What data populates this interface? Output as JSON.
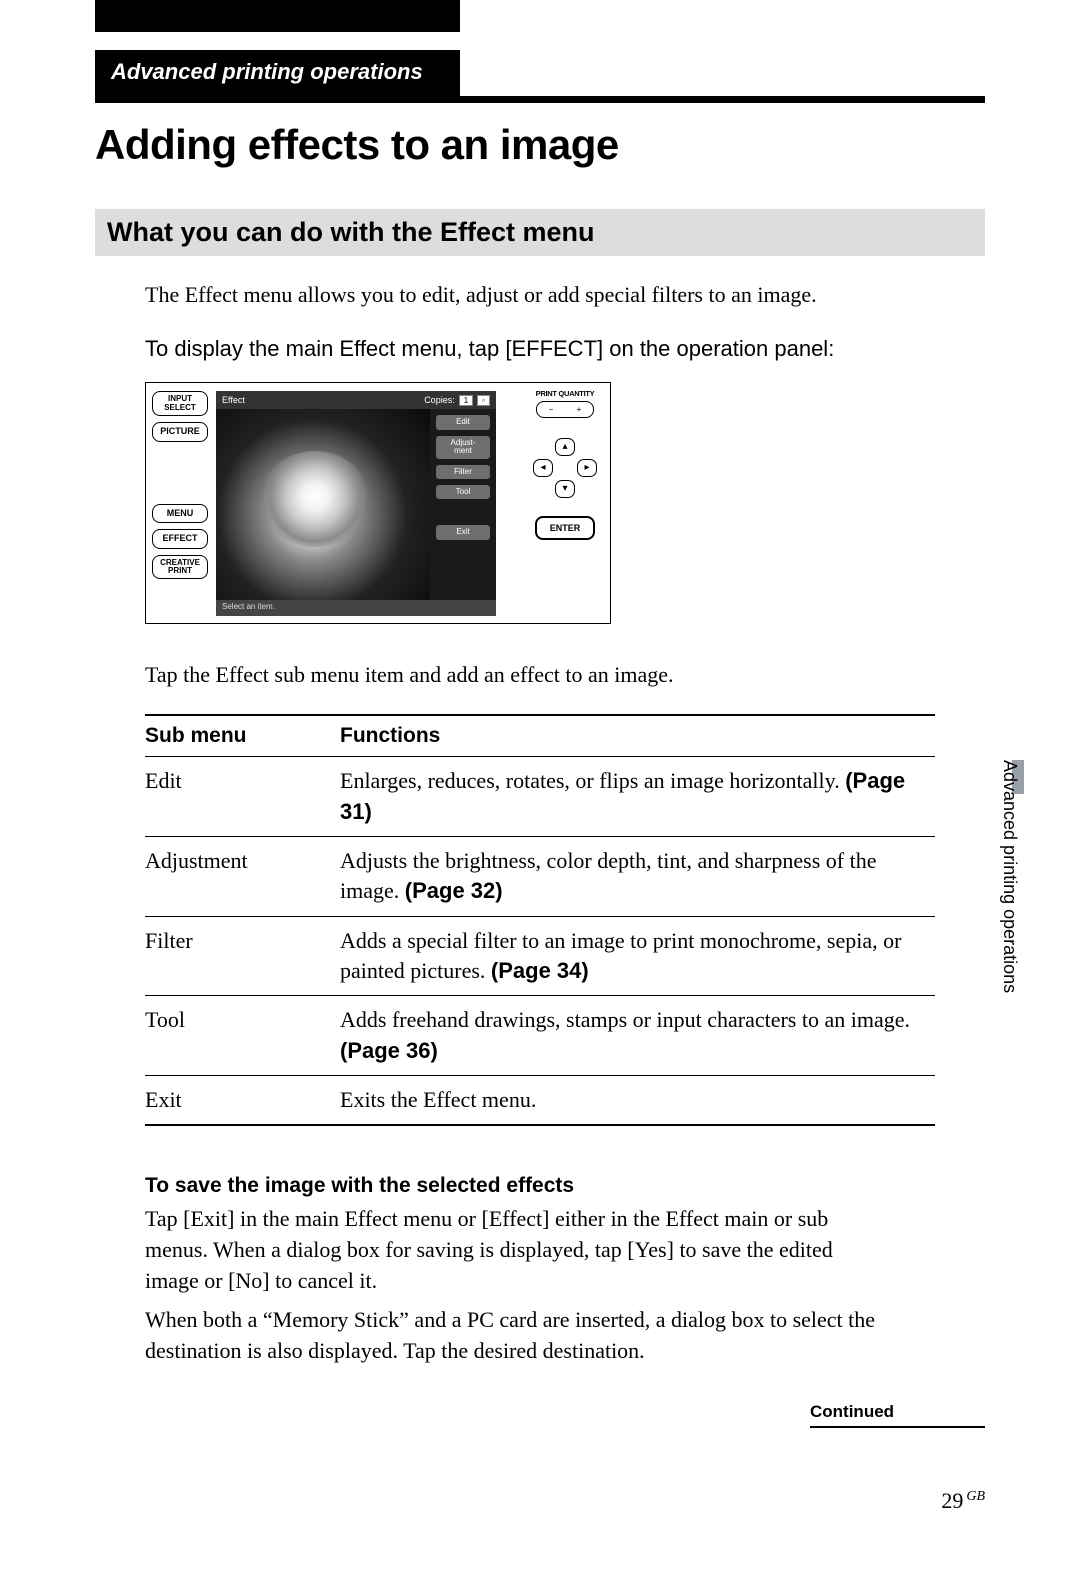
{
  "section_header": "Advanced printing operations",
  "page_title": "Adding effects to an image",
  "subheading": "What you can do with the Effect menu",
  "intro": "The Effect menu allows you to edit, adjust or add special filters to an image.",
  "display_instructions": "To display the main Effect menu, tap [EFFECT] on the operation panel:",
  "screenshot": {
    "left_buttons": {
      "input_select": "INPUT\nSELECT",
      "picture": "PICTURE",
      "menu": "MENU",
      "effect": "EFFECT",
      "creative_print": "CREATIVE\nPRINT"
    },
    "top_bar": {
      "title": "Effect",
      "copies_label": "Copies:",
      "copies_value": "1"
    },
    "side_buttons": {
      "edit": "Edit",
      "adjustment": "Adjust-\nment",
      "filter": "Filter",
      "tool": "Tool",
      "exit": "Exit"
    },
    "status": "Select an item.",
    "right": {
      "print_qty_label": "PRINT QUANTITY",
      "minus": "−",
      "plus": "+",
      "enter": "ENTER"
    }
  },
  "after_screenshot": "Tap the Effect sub menu item and add an effect to an image.",
  "table": {
    "headers": {
      "col1": "Sub menu",
      "col2": "Functions"
    },
    "rows": [
      {
        "name": "Edit",
        "desc": "Enlarges, reduces, rotates, or flips an image horizontally. ",
        "page": "(Page 31)"
      },
      {
        "name": "Adjustment",
        "desc": "Adjusts the brightness, color depth, tint, and sharpness of the image. ",
        "page": "(Page 32)"
      },
      {
        "name": "Filter",
        "desc": "Adds a special filter to an image to print monochrome, sepia, or painted pictures. ",
        "page": "(Page 34)"
      },
      {
        "name": "Tool",
        "desc": "Adds freehand drawings, stamps or input characters to an image. ",
        "page": "(Page 36)"
      },
      {
        "name": "Exit",
        "desc": "Exits the Effect menu.",
        "page": ""
      }
    ]
  },
  "save_heading": "To save the image with the selected effects",
  "save_para1": "Tap [Exit] in the main Effect menu or [Effect] either in the Effect main or sub menus.  When a dialog box for saving is displayed, tap [Yes] to save the edited image or [No] to cancel it.",
  "save_para2": "When both a “Memory Stick” and a PC card are inserted, a dialog box to select the destination is also displayed.  Tap the desired destination.",
  "continued": "Continued",
  "side_tab": "Advanced printing operations",
  "page_number": "29",
  "page_region": "GB"
}
